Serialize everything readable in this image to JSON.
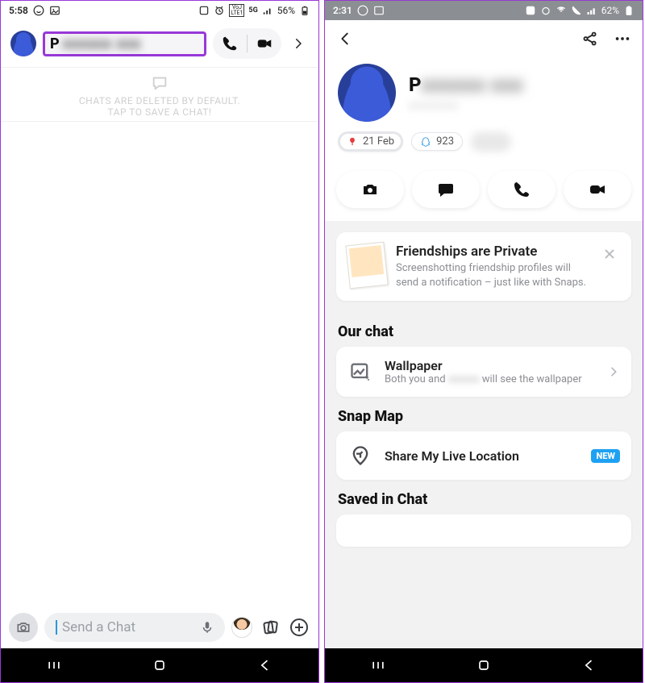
{
  "left": {
    "status": {
      "time": "5:58",
      "battery": "56%",
      "net_top": "VoJ",
      "net_bot": "LTE1",
      "net_side": "5G"
    },
    "header": {
      "name_initial": "P",
      "name_blur": "xxxxxx  xxx"
    },
    "empty": {
      "line1": "CHATS ARE DELETED BY DEFAULT.",
      "line2": "TAP TO SAVE A CHAT!"
    },
    "input": {
      "placeholder": "Send a Chat"
    }
  },
  "right": {
    "status": {
      "time": "2:31",
      "battery": "62%"
    },
    "profile": {
      "name_initial": "P",
      "name_blur": "xxxxxx  xxx",
      "sub_blur": "xxxxxxx"
    },
    "chips": {
      "birthday": "21 Feb",
      "snapscore": "923"
    },
    "privacy": {
      "title": "Friendships are Private",
      "body": "Screenshotting friendship profiles will send a notification – just like with Snaps."
    },
    "sections": {
      "our_chat": "Our chat",
      "wallpaper_title": "Wallpaper",
      "wallpaper_sub_a": "Both you and ",
      "wallpaper_sub_blur": "xxxxxx",
      "wallpaper_sub_b": " will see the wallpaper",
      "snap_map": "Snap Map",
      "share_location": "Share My Live Location",
      "new_label": "NEW",
      "saved": "Saved in Chat"
    }
  }
}
